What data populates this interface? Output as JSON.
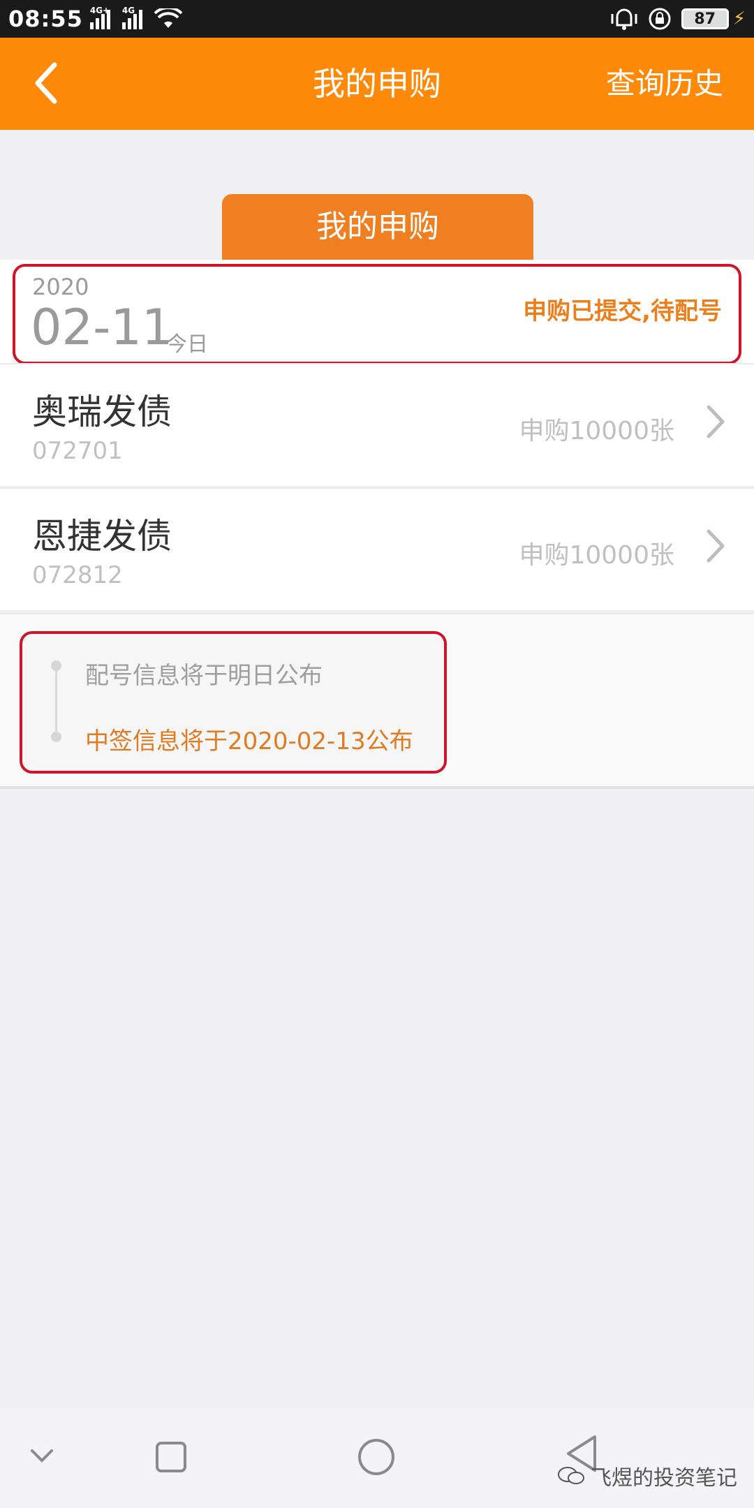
{
  "status_bar": {
    "time": "08:55",
    "signal1_tag": "4G+",
    "signal2_tag": "4G",
    "battery_level": "87",
    "icons": [
      "signal-icon",
      "wifi-icon",
      "vibrate-icon",
      "lock-rotation-icon",
      "battery-icon",
      "charging-icon"
    ]
  },
  "header": {
    "title": "我的申购",
    "history_label": "查询历史",
    "bg_color": "#ff8a0a"
  },
  "tab": {
    "label": "我的申购",
    "color": "#ef7f21"
  },
  "date_section": {
    "year": "2020",
    "month_day": "02-11",
    "today_label": "今日",
    "status": "申购已提交,待配号",
    "status_color": "#ea7f1c"
  },
  "bonds": [
    {
      "name": "奥瑞发债",
      "code": "072701",
      "amount": "申购10000张"
    },
    {
      "name": "恩捷发债",
      "code": "072812",
      "amount": "申购10000张"
    }
  ],
  "info": {
    "line1": "配号信息将于明日公布",
    "line2": "中签信息将于2020-02-13公布"
  },
  "watermark": {
    "text": "飞煜的投资笔记"
  },
  "highlight_color": "#d0152b"
}
